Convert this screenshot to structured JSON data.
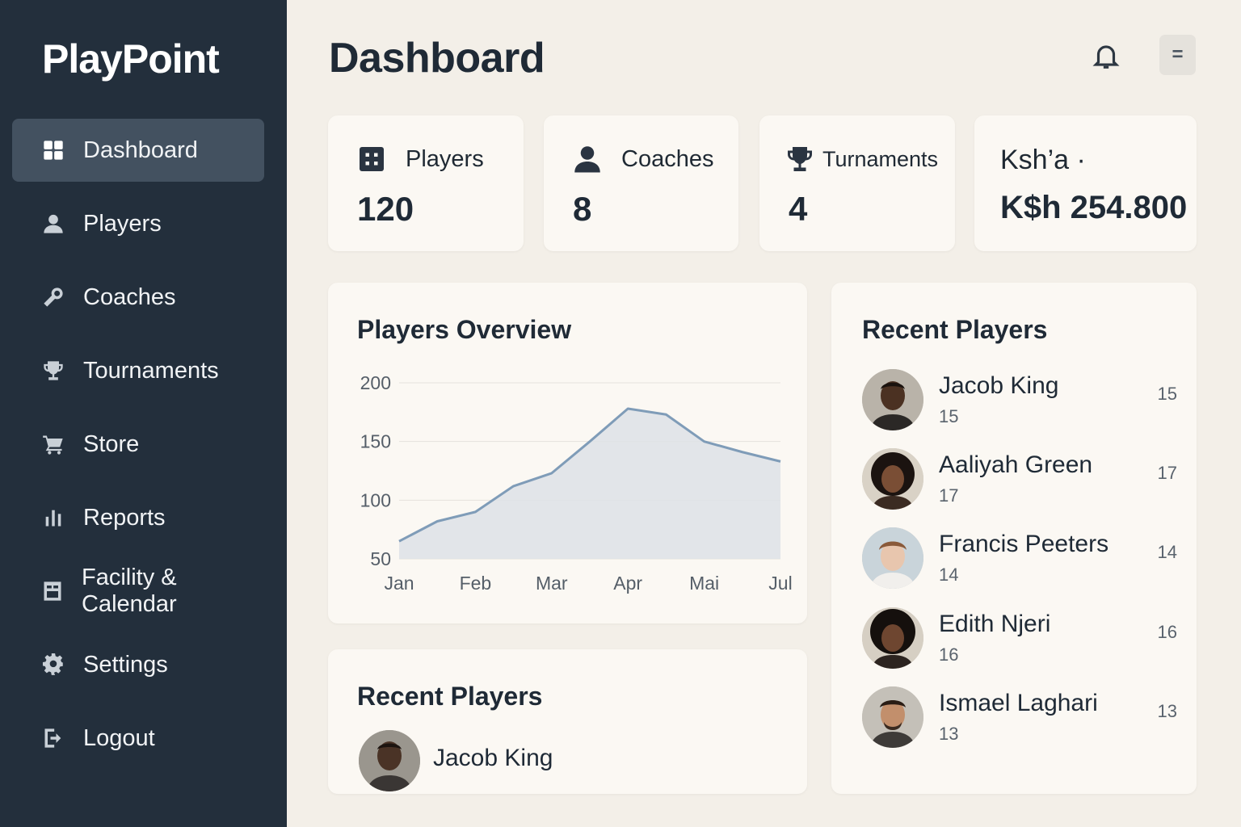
{
  "app": {
    "brand": "PlayPoint"
  },
  "sidebar": {
    "items": [
      {
        "label": "Dashboard",
        "icon": "grid-icon",
        "active": true
      },
      {
        "label": "Players",
        "icon": "user-icon",
        "active": false
      },
      {
        "label": "Coaches",
        "icon": "whistle-icon",
        "active": false
      },
      {
        "label": "Tournaments",
        "icon": "trophy-icon",
        "active": false
      },
      {
        "label": "Store",
        "icon": "cart-icon",
        "active": false
      },
      {
        "label": "Reports",
        "icon": "bar-chart-icon",
        "active": false
      },
      {
        "label": "Facility & Calendar",
        "icon": "calendar-icon",
        "active": false
      },
      {
        "label": "Settings",
        "icon": "gear-icon",
        "active": false
      },
      {
        "label": "Logout",
        "icon": "logout-icon",
        "active": false
      }
    ]
  },
  "header": {
    "title": "Dashboard"
  },
  "stats": [
    {
      "label": "Players",
      "value": "120",
      "icon": "grid-icon"
    },
    {
      "label": "Coaches",
      "value": "8",
      "icon": "user-icon"
    },
    {
      "label": "Turnaments",
      "value": "4",
      "icon": "trophy-icon"
    },
    {
      "label": "Ksh’a ·",
      "value": "K$h 254.800",
      "icon": ""
    }
  ],
  "overview": {
    "title": "Players Overview"
  },
  "chart_data": {
    "type": "area",
    "categories": [
      "Jan",
      "Feb",
      "Mar",
      "Apr",
      "Mai",
      "Jul"
    ],
    "x": [
      0,
      0.5,
      1,
      1.5,
      2,
      2.5,
      3,
      3.5,
      4,
      4.5,
      5
    ],
    "values": [
      65,
      82,
      90,
      112,
      123,
      150,
      178,
      173,
      150,
      141,
      133
    ],
    "yticks": [
      50,
      100,
      150,
      200
    ],
    "ylim": [
      50,
      200
    ],
    "grid": true,
    "line_color": "#7f9cb8",
    "fill_color": "#dde2e6"
  },
  "recent_small": {
    "title": "Recent Players",
    "name": "Jacob King"
  },
  "recent_players": {
    "title": "Recent Players",
    "players": [
      {
        "name": "Jacob King",
        "sub": "15",
        "age": "15"
      },
      {
        "name": "Aaliyah Green",
        "sub": "17",
        "age": "17"
      },
      {
        "name": "Francis Peeters",
        "sub": "14",
        "age": "14"
      },
      {
        "name": "Edith Njeri",
        "sub": "16",
        "age": "16"
      },
      {
        "name": "Ismael Laghari",
        "sub": "13",
        "age": "13"
      }
    ]
  },
  "colors": {
    "sidebar": "#232f3c",
    "active": "#435160",
    "background": "#f3efe8",
    "card": "#fbf8f3"
  }
}
